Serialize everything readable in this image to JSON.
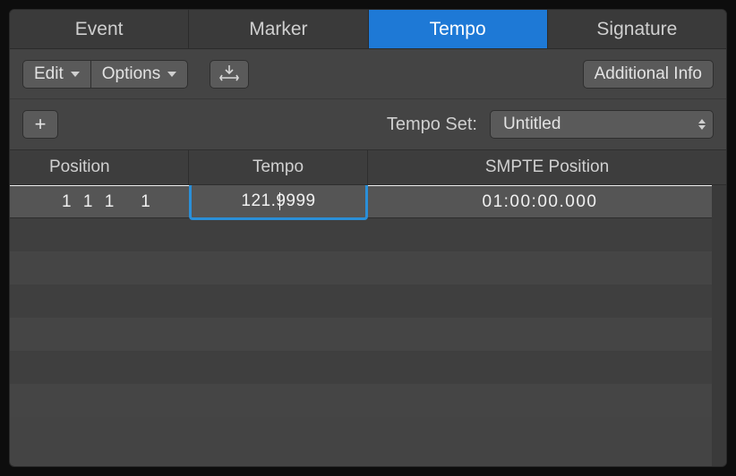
{
  "tabs": {
    "items": [
      {
        "label": "Event",
        "active": false
      },
      {
        "label": "Marker",
        "active": false
      },
      {
        "label": "Tempo",
        "active": true
      },
      {
        "label": "Signature",
        "active": false
      }
    ]
  },
  "toolbar": {
    "edit_label": "Edit",
    "options_label": "Options",
    "catch_icon": "playhead-catch-icon",
    "additional_info_label": "Additional Info"
  },
  "add_button_glyph": "+",
  "tempo_set_label": "Tempo Set:",
  "tempo_set_value": "Untitled",
  "table": {
    "headers": {
      "position": "Position",
      "tempo": "Tempo",
      "smpte": "SMPTE Position"
    },
    "rows": [
      {
        "position_bars": "1 1 1",
        "position_ticks": "1",
        "tempo": "121.9999",
        "smpte": "01:00:00.000"
      }
    ]
  }
}
